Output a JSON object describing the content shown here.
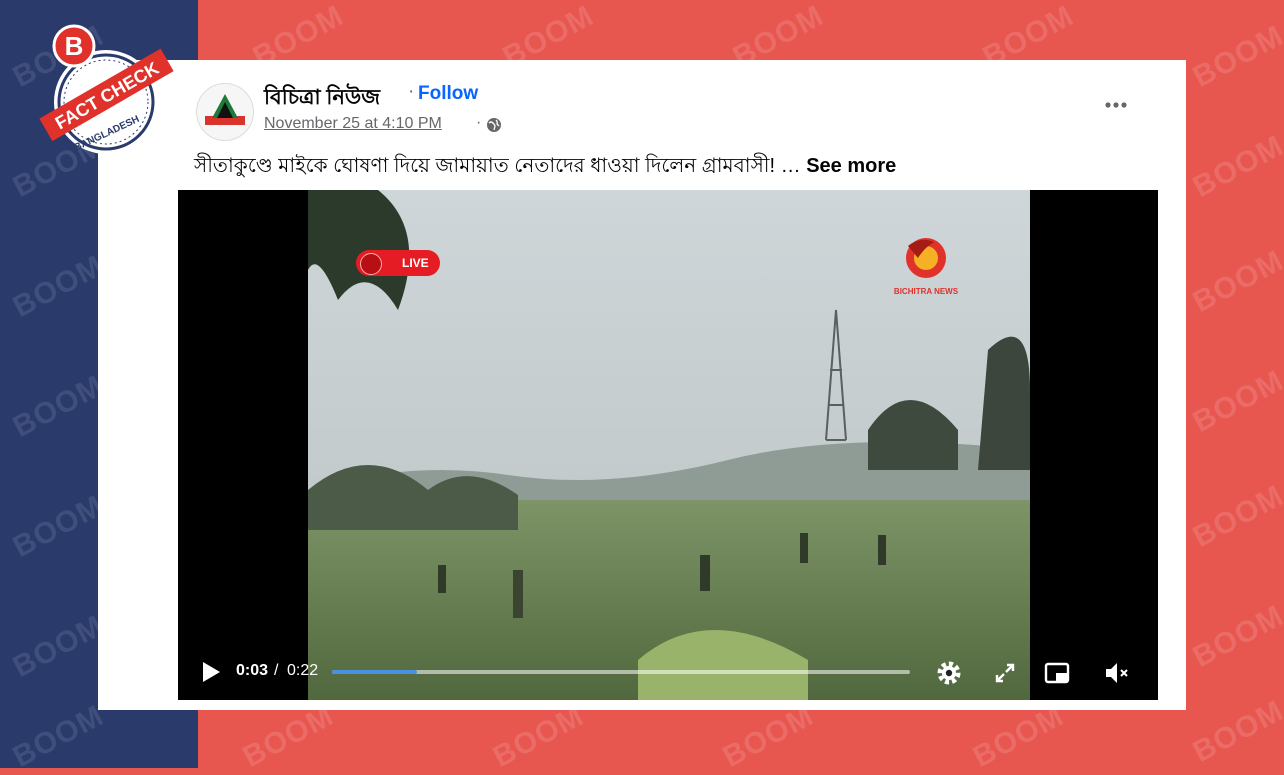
{
  "colors": {
    "background_left": "#2a3a6b",
    "background_right": "#e85650",
    "link_blue": "#0866ff",
    "progress_blue": "#4a90e2",
    "live_red": "#e51c23"
  },
  "watermark": {
    "text": "BOOM"
  },
  "badge": {
    "letter": "B",
    "title": "FACT CHECK",
    "region": "BANGLADESH"
  },
  "post": {
    "page_name": "বিচিত্রা নিউজ",
    "separator": "·",
    "follow_label": "Follow",
    "timestamp": "November 25 at 4:10 PM",
    "privacy_icon": "globe-icon",
    "more_icon": "more-options-icon",
    "caption": "সীতাকুণ্ডে মাইকে ঘোষণা দিয়ে জামায়াত নেতাদের ধাওয়া দিলেন গ্রামবাসী! … ",
    "see_more_label": "See more"
  },
  "video": {
    "live_label": "LIVE",
    "channel_logo_text": "BICHITRA NEWS",
    "current_time": "0:03",
    "time_separator": "/",
    "duration": "0:22",
    "progress_fraction": 0.147,
    "icons": [
      "play-icon",
      "settings-icon",
      "fullscreen-icon",
      "picture-in-picture-icon",
      "mute-icon"
    ]
  }
}
